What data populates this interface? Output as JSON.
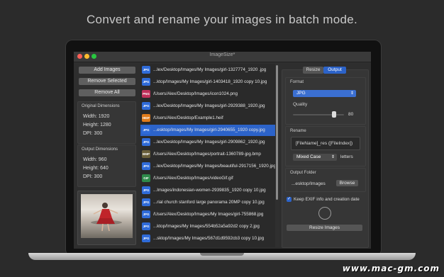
{
  "headline": "Convert and rename your images in batch mode.",
  "window": {
    "title": "ImageSize*"
  },
  "left": {
    "add_images": "Add Images",
    "remove_selected": "Remove Selected",
    "remove_all": "Remove All",
    "original_title": "Original Dimensions",
    "original": {
      "width": "Width: 1920",
      "height": "Height: 1280",
      "dpi": "DPI: 300"
    },
    "output_title": "Output Dimensions",
    "output": {
      "width": "Width: 960",
      "height": "Height: 640",
      "dpi": "DPI: 300"
    }
  },
  "files": [
    {
      "badge": "JPG",
      "color": "#2f6bd8",
      "path": "...lex/Desktop/Images/My Images/girl-1327774_1920 .jpg",
      "selected": false
    },
    {
      "badge": "JPG",
      "color": "#2f6bd8",
      "path": "...ktop/Images/My Images/girl-1403418_1920 copy 10.jpg",
      "selected": false
    },
    {
      "badge": "PNG",
      "color": "#c0305a",
      "path": "/Users/Alex/Desktop/Images/icon1024.png",
      "selected": false
    },
    {
      "badge": "JPG",
      "color": "#2f6bd8",
      "path": "...lex/Desktop/Images/My Images/girl-2929388_1920.jpg",
      "selected": false
    },
    {
      "badge": "HEIF",
      "color": "#e07b1a",
      "path": "/Users/Alex/Desktop/Example1.heif",
      "selected": false
    },
    {
      "badge": "JPG",
      "color": "#2f6bd8",
      "path": "...esktop/Images/My Images/girl-2940655_1920 copy.jpg",
      "selected": true
    },
    {
      "badge": "JPG",
      "color": "#2f6bd8",
      "path": "...lex/Desktop/Images/My Images/girl-2909862_1920.jpg",
      "selected": false
    },
    {
      "badge": "BMP",
      "color": "#6a5f3a",
      "path": "/Users/Alex/Desktop/Images/portrait-1360789-jpg.bmp",
      "selected": false
    },
    {
      "badge": "JPG",
      "color": "#2f6bd8",
      "path": "...lex/Desktop/Images/My Images/beautiful-2917156_1920.jpg",
      "selected": false
    },
    {
      "badge": "GIF",
      "color": "#2e8a4a",
      "path": "/Users/Alex/Desktop/Images/videoGif.gif",
      "selected": false
    },
    {
      "badge": "JPG",
      "color": "#2f6bd8",
      "path": "...Images/indonesian-women-2939835_1920 copy 10.jpg",
      "selected": false
    },
    {
      "badge": "JPG",
      "color": "#2f6bd8",
      "path": "...rial church stanford large panorama 20MP copy 10.jpg",
      "selected": false
    },
    {
      "badge": "JPG",
      "color": "#2f6bd8",
      "path": "/Users/Alex/Desktop/Images/My Images/girl-755868.jpg",
      "selected": false
    },
    {
      "badge": "JPG",
      "color": "#2f6bd8",
      "path": "...ktop/Images/My Images/554b52a5a92d2 copy 2.jpg",
      "selected": false
    },
    {
      "badge": "JPG",
      "color": "#2f6bd8",
      "path": "...sktop/Images/My Images/567d1d9592cb3 copy 10.jpg",
      "selected": false
    }
  ],
  "right": {
    "tabs": [
      {
        "label": "Resize",
        "active": false
      },
      {
        "label": "Output",
        "active": true
      }
    ],
    "format_title": "Format",
    "format_value": "JPG",
    "quality_label": "Quality",
    "quality_value": "80",
    "quality_fraction": 0.8,
    "rename_title": "Rename",
    "rename_pattern": "[FileName]_res ([FileIndex])",
    "case_value": "Mixed Case",
    "letters_label": "letters",
    "output_folder_title": "Output Folder",
    "output_folder_path": "...esktop/Images",
    "browse": "Browse",
    "keep_exif": "Keep EXIF info and creation date",
    "keep_exif_checked": true,
    "resize_button": "Resize Images"
  },
  "watermark": "www.mac-gm.com",
  "colors": {
    "accent": "#2c63c9",
    "background": "#2b2b2b"
  }
}
